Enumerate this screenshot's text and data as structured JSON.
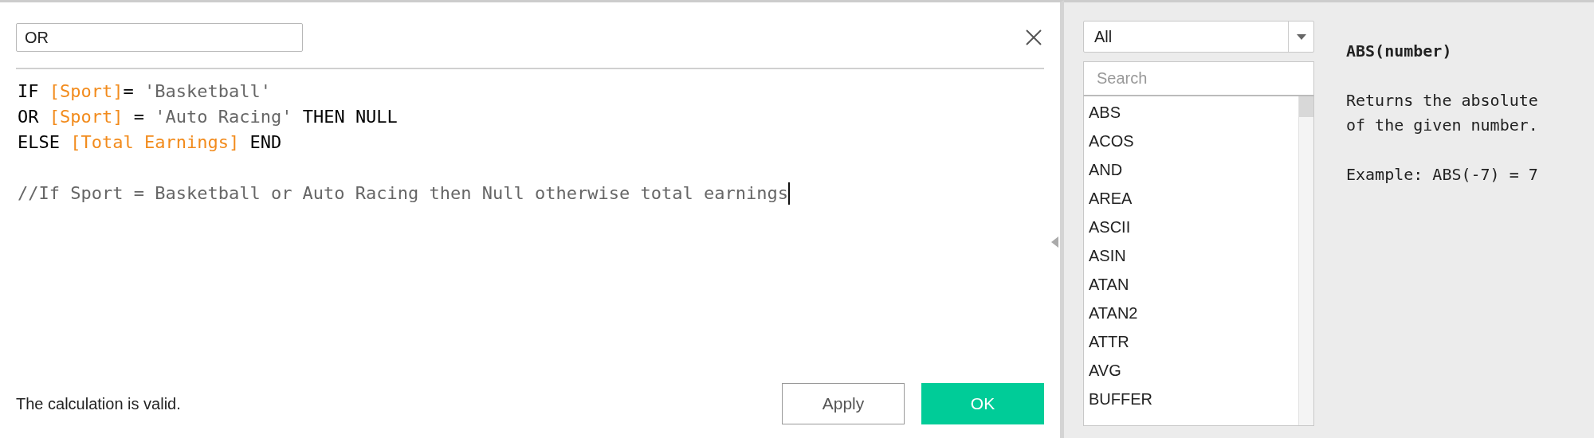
{
  "editor": {
    "name_field": {
      "value": "OR"
    },
    "code_lines": [
      {
        "tokens": [
          {
            "kind": "keyword",
            "text": "IF "
          },
          {
            "kind": "field",
            "text": "[Sport]"
          },
          {
            "kind": "keyword",
            "text": "= "
          },
          {
            "kind": "string",
            "text": "'Basketball'"
          }
        ]
      },
      {
        "tokens": [
          {
            "kind": "keyword",
            "text": "OR "
          },
          {
            "kind": "field",
            "text": "[Sport]"
          },
          {
            "kind": "keyword",
            "text": " = "
          },
          {
            "kind": "string",
            "text": "'Auto Racing'"
          },
          {
            "kind": "keyword",
            "text": " THEN NULL"
          }
        ]
      },
      {
        "tokens": [
          {
            "kind": "keyword",
            "text": "ELSE "
          },
          {
            "kind": "field",
            "text": "[Total Earnings]"
          },
          {
            "kind": "keyword",
            "text": " END"
          }
        ]
      }
    ],
    "comment": "//If Sport = Basketball or Auto Racing then Null otherwise total earnings",
    "status": "The calculation is valid.",
    "buttons": [
      {
        "kind": "secondary",
        "label": "Apply"
      },
      {
        "kind": "primary",
        "label": "OK"
      }
    ]
  },
  "functions": {
    "category": "All",
    "search": {
      "placeholder": "Search"
    },
    "items": [
      "ABS",
      "ACOS",
      "AND",
      "AREA",
      "ASCII",
      "ASIN",
      "ATAN",
      "ATAN2",
      "ATTR",
      "AVG",
      "BUFFER"
    ],
    "help": {
      "signature": "ABS(number)",
      "description": [
        "Returns the absolute",
        "of the given number."
      ],
      "example": "Example: ABS(-7) = 7"
    }
  }
}
